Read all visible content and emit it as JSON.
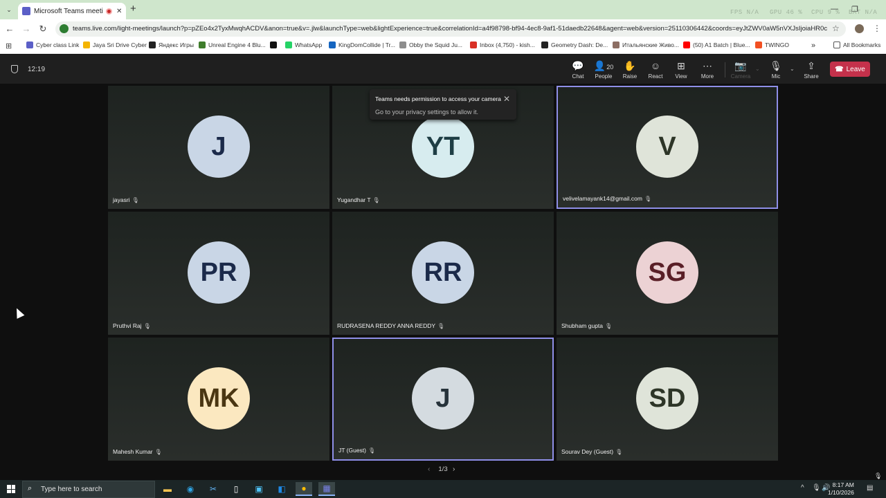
{
  "browser": {
    "tab_title": "Microsoft Teams meeting |",
    "new_tab": "+",
    "hud": {
      "fps": "FPS N/A",
      "gpu": "GPU 46 %",
      "cpu": "CPU 9 %",
      "bat": "BAT N/A"
    },
    "url": "teams.live.com/light-meetings/launch?p=pZEo4x2TyxMwqhACDV&anon=true&v=.jlw&launchType=web&lightExperience=true&correlationId=a4f98798-bf94-4ec8-9af1-51daedb22648&agent=web&version=25110306442&coords=eyJtZWV0aW5nVXJsIjoiaHR0cH...",
    "bookmarks": [
      {
        "label": "Cyber class Link",
        "color": "#5b5fc7"
      },
      {
        "label": "Jaya Sri Drive Cyber",
        "color": "#f4b400"
      },
      {
        "label": "Яндекс Игры",
        "color": "#222222"
      },
      {
        "label": "Unreal Engine 4 Blu...",
        "color": "#3f7d2c"
      },
      {
        "label": "",
        "color": "#111111"
      },
      {
        "label": "WhatsApp",
        "color": "#25d366"
      },
      {
        "label": "KingDomCollide | Tr...",
        "color": "#1565c0"
      },
      {
        "label": "Obby the Squid Ju...",
        "color": "#8d8d8d"
      },
      {
        "label": "Inbox (4,750) - kish...",
        "color": "#d93025"
      },
      {
        "label": "Geometry Dash: De...",
        "color": "#222222"
      },
      {
        "label": "Итальянские Живо...",
        "color": "#8d6e63"
      },
      {
        "label": "(50) A1 Batch | Blue...",
        "color": "#ff0000"
      },
      {
        "label": "TWINGO",
        "color": "#f25022"
      }
    ],
    "more_bookmarks": "»",
    "all_bookmarks": "All Bookmarks"
  },
  "meeting": {
    "timer": "12:19",
    "toolbar": [
      {
        "label": "Chat",
        "icon": "💬"
      },
      {
        "label": "People",
        "icon": "👤",
        "count": "20"
      },
      {
        "label": "Raise",
        "icon": "✋"
      },
      {
        "label": "React",
        "icon": "☺"
      },
      {
        "label": "View",
        "icon": "⊞"
      },
      {
        "label": "More",
        "icon": "⋯"
      },
      {
        "label": "Camera",
        "icon": "📷"
      },
      {
        "label": "Mic",
        "icon": "🎙"
      },
      {
        "label": "Share",
        "icon": "⇪"
      }
    ],
    "leave_label": "Leave",
    "toast": {
      "title": "Teams needs permission to access your camera",
      "body": "Go to your privacy settings to allow it."
    },
    "participants": [
      {
        "initials": "J",
        "name": "jayasri",
        "bg": "#c9d6e6",
        "fg": "#1b2a4a"
      },
      {
        "initials": "YT",
        "name": "Yugandhar T",
        "bg": "#d7ecef",
        "fg": "#1e3e45"
      },
      {
        "initials": "V",
        "name": "velivelamayank14@gmail.com",
        "bg": "#dfe4d9",
        "fg": "#2d3527"
      },
      {
        "initials": "PR",
        "name": "Pruthvi Raj",
        "bg": "#c9d6e6",
        "fg": "#1b2a4a"
      },
      {
        "initials": "RR",
        "name": "RUDRASENA REDDY ANNA REDDY",
        "bg": "#c9d6e6",
        "fg": "#1b2a4a"
      },
      {
        "initials": "SG",
        "name": "Shubham gupta",
        "bg": "#ecd2d4",
        "fg": "#5a1f27"
      },
      {
        "initials": "MK",
        "name": "Mahesh Kumar",
        "bg": "#fbe8c0",
        "fg": "#4a3612"
      },
      {
        "initials": "J",
        "name": "JT (Guest)",
        "bg": "#d4dbe0",
        "fg": "#26323a"
      },
      {
        "initials": "SD",
        "name": "Sourav Dey (Guest)",
        "bg": "#dfe4d9",
        "fg": "#2d3527"
      }
    ],
    "pager": "1/3"
  },
  "taskbar": {
    "search_placeholder": "Type here to search",
    "time": "8:17 AM",
    "date": "1/10/2026"
  }
}
